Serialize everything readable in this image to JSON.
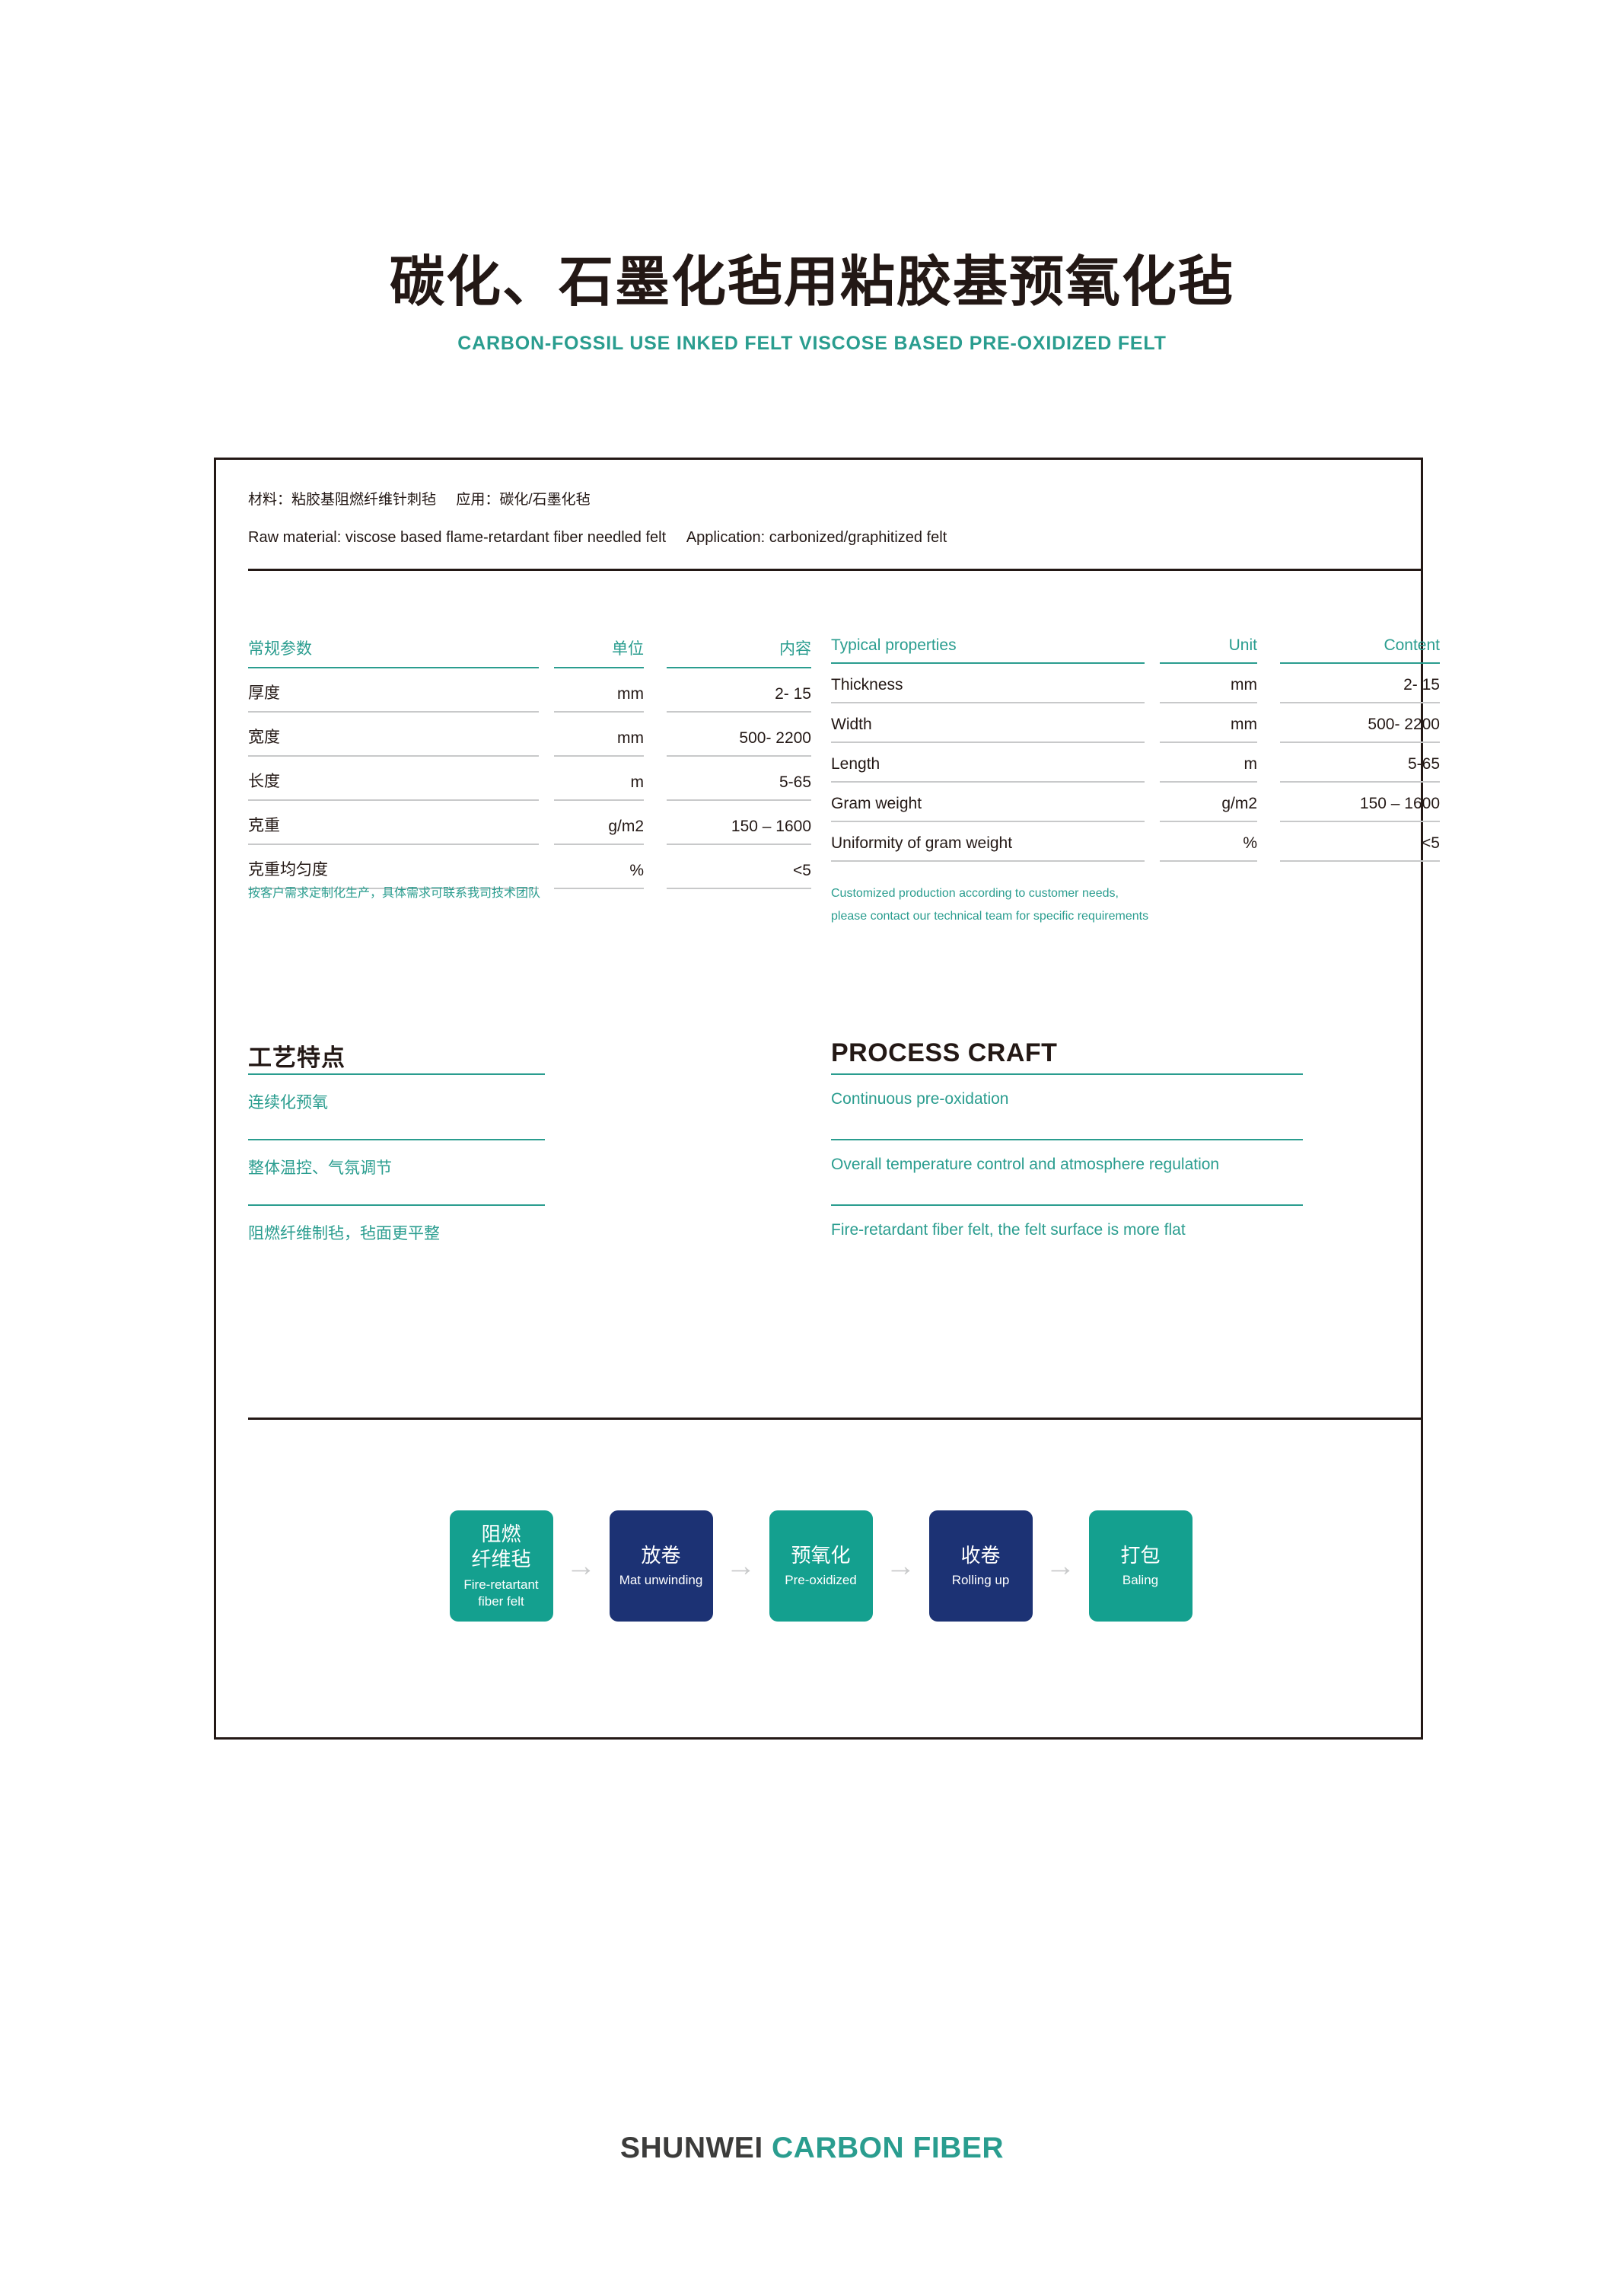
{
  "header": {
    "title_cn": "碳化、石墨化毡用粘胶基预氧化毡",
    "title_en": "CARBON-FOSSIL USE INKED FELT VISCOSE BASED PRE-OXIDIZED FELT"
  },
  "material_info": {
    "line_cn": "材料：粘胶基阻燃纤维针刺毡     应用：碳化/石墨化毡",
    "line_en": "Raw material: viscose based flame-retardant fiber needled felt     Application: carbonized/graphitized felt"
  },
  "spec_table_cn": {
    "headers": [
      "常规参数",
      "单位",
      "内容"
    ],
    "rows": [
      {
        "name": "厚度",
        "unit": "mm",
        "value": "2- 15"
      },
      {
        "name": "宽度",
        "unit": "mm",
        "value": "500- 2200"
      },
      {
        "name": "长度",
        "unit": "m",
        "value": "5-65"
      },
      {
        "name": "克重",
        "unit": "g/m2",
        "value": "150 – 1600"
      },
      {
        "name": "克重均匀度",
        "unit": "%",
        "value": "<5"
      }
    ]
  },
  "spec_table_en": {
    "headers": [
      "Typical properties",
      "Unit",
      "Content"
    ],
    "rows": [
      {
        "name": "Thickness",
        "unit": "mm",
        "value": "2- 15"
      },
      {
        "name": "Width",
        "unit": "mm",
        "value": "500- 2200"
      },
      {
        "name": "Length",
        "unit": "m",
        "value": "5-65"
      },
      {
        "name": "Gram weight",
        "unit": "g/m2",
        "value": "150 – 1600"
      },
      {
        "name": "Uniformity of gram weight",
        "unit": "%",
        "value": "<5"
      }
    ]
  },
  "note": {
    "cn": "按客户需求定制化生产，具体需求可联系我司技术团队",
    "en_line1": "Customized production according to customer needs,",
    "en_line2": "please contact our technical team for specific requirements"
  },
  "craft": {
    "title_cn": "工艺特点",
    "title_en": "PROCESS CRAFT",
    "items_cn": [
      "连续化预氧",
      "整体温控、气氛调节",
      "阻燃纤维制毡，毡面更平整"
    ],
    "items_en": [
      "Continuous pre-oxidation",
      "Overall temperature control and atmosphere regulation",
      "Fire-retardant fiber felt, the felt surface is more flat"
    ]
  },
  "flow": {
    "arrow": "→",
    "steps": [
      {
        "cn": "阻燃\n纤维毡",
        "en": "Fire-retartant\nfiber felt",
        "color": "#14a08f"
      },
      {
        "cn": "放卷",
        "en": "Mat unwinding",
        "color": "#1c3274"
      },
      {
        "cn": "预氧化",
        "en": "Pre-oxidized",
        "color": "#14a08f"
      },
      {
        "cn": "收卷",
        "en": "Rolling up",
        "color": "#1c3274"
      },
      {
        "cn": "打包",
        "en": "Baling",
        "color": "#14a08f"
      }
    ]
  },
  "footer": {
    "logo_dark": "SHUNWEI",
    "logo_teal": "CARBON FIBER"
  },
  "colors": {
    "teal": "#2a9d8f",
    "teal_box": "#14a08f",
    "navy": "#1c3274",
    "ink": "#231815",
    "rule_gray": "#c8c9ca",
    "arrow_gray": "#c9cacb"
  }
}
